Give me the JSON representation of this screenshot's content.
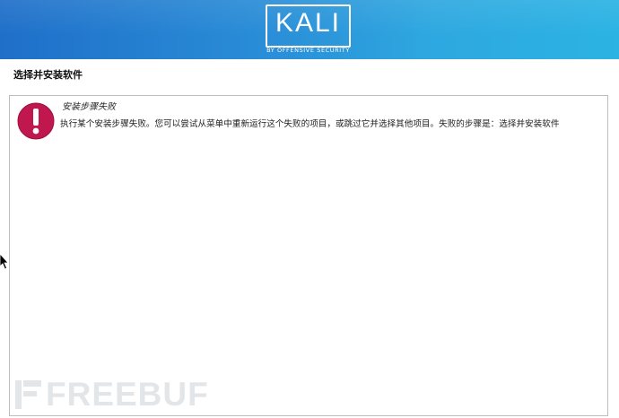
{
  "header": {
    "logo_text": "KALI",
    "logo_subtitle": "BY OFFENSIVE SECURITY",
    "colors": {
      "gradient_start": "#1f6fc9",
      "gradient_end": "#2bb3e3"
    }
  },
  "page": {
    "title": "选择并安装软件"
  },
  "error": {
    "icon": "exclamation-circle-icon",
    "icon_color": "#c0174f",
    "title": "安装步骤失败",
    "message": "执行某个安装步骤失败。您可以尝试从菜单中重新运行这个失败的项目，或跳过它并选择其他项目。失败的步骤是：选择并安装软件"
  },
  "watermark": {
    "text": "FREEBUF",
    "icon": "freebuf-logo-icon"
  },
  "cursor": {
    "icon": "mouse-pointer-icon"
  }
}
